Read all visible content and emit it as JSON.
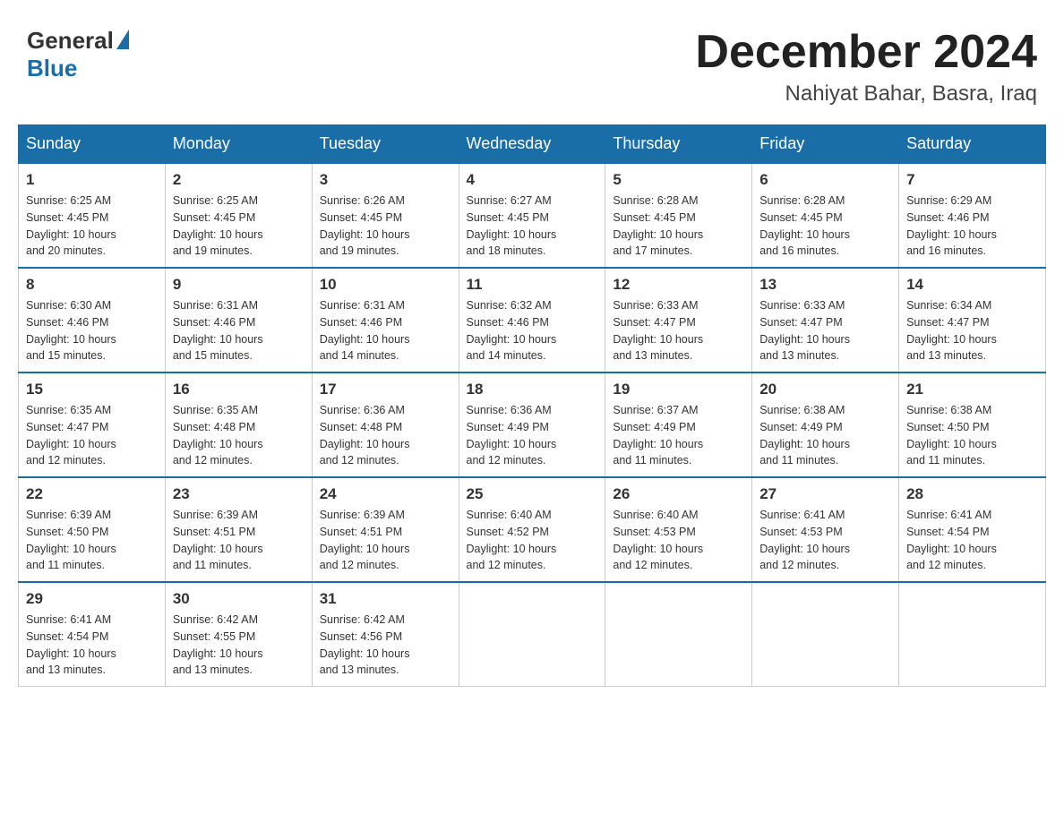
{
  "header": {
    "logo_general": "General",
    "logo_blue": "Blue",
    "month_title": "December 2024",
    "location": "Nahiyat Bahar, Basra, Iraq"
  },
  "days_of_week": [
    "Sunday",
    "Monday",
    "Tuesday",
    "Wednesday",
    "Thursday",
    "Friday",
    "Saturday"
  ],
  "weeks": [
    [
      {
        "day": "1",
        "sunrise": "6:25 AM",
        "sunset": "4:45 PM",
        "daylight": "10 hours and 20 minutes."
      },
      {
        "day": "2",
        "sunrise": "6:25 AM",
        "sunset": "4:45 PM",
        "daylight": "10 hours and 19 minutes."
      },
      {
        "day": "3",
        "sunrise": "6:26 AM",
        "sunset": "4:45 PM",
        "daylight": "10 hours and 19 minutes."
      },
      {
        "day": "4",
        "sunrise": "6:27 AM",
        "sunset": "4:45 PM",
        "daylight": "10 hours and 18 minutes."
      },
      {
        "day": "5",
        "sunrise": "6:28 AM",
        "sunset": "4:45 PM",
        "daylight": "10 hours and 17 minutes."
      },
      {
        "day": "6",
        "sunrise": "6:28 AM",
        "sunset": "4:45 PM",
        "daylight": "10 hours and 16 minutes."
      },
      {
        "day": "7",
        "sunrise": "6:29 AM",
        "sunset": "4:46 PM",
        "daylight": "10 hours and 16 minutes."
      }
    ],
    [
      {
        "day": "8",
        "sunrise": "6:30 AM",
        "sunset": "4:46 PM",
        "daylight": "10 hours and 15 minutes."
      },
      {
        "day": "9",
        "sunrise": "6:31 AM",
        "sunset": "4:46 PM",
        "daylight": "10 hours and 15 minutes."
      },
      {
        "day": "10",
        "sunrise": "6:31 AM",
        "sunset": "4:46 PM",
        "daylight": "10 hours and 14 minutes."
      },
      {
        "day": "11",
        "sunrise": "6:32 AM",
        "sunset": "4:46 PM",
        "daylight": "10 hours and 14 minutes."
      },
      {
        "day": "12",
        "sunrise": "6:33 AM",
        "sunset": "4:47 PM",
        "daylight": "10 hours and 13 minutes."
      },
      {
        "day": "13",
        "sunrise": "6:33 AM",
        "sunset": "4:47 PM",
        "daylight": "10 hours and 13 minutes."
      },
      {
        "day": "14",
        "sunrise": "6:34 AM",
        "sunset": "4:47 PM",
        "daylight": "10 hours and 13 minutes."
      }
    ],
    [
      {
        "day": "15",
        "sunrise": "6:35 AM",
        "sunset": "4:47 PM",
        "daylight": "10 hours and 12 minutes."
      },
      {
        "day": "16",
        "sunrise": "6:35 AM",
        "sunset": "4:48 PM",
        "daylight": "10 hours and 12 minutes."
      },
      {
        "day": "17",
        "sunrise": "6:36 AM",
        "sunset": "4:48 PM",
        "daylight": "10 hours and 12 minutes."
      },
      {
        "day": "18",
        "sunrise": "6:36 AM",
        "sunset": "4:49 PM",
        "daylight": "10 hours and 12 minutes."
      },
      {
        "day": "19",
        "sunrise": "6:37 AM",
        "sunset": "4:49 PM",
        "daylight": "10 hours and 11 minutes."
      },
      {
        "day": "20",
        "sunrise": "6:38 AM",
        "sunset": "4:49 PM",
        "daylight": "10 hours and 11 minutes."
      },
      {
        "day": "21",
        "sunrise": "6:38 AM",
        "sunset": "4:50 PM",
        "daylight": "10 hours and 11 minutes."
      }
    ],
    [
      {
        "day": "22",
        "sunrise": "6:39 AM",
        "sunset": "4:50 PM",
        "daylight": "10 hours and 11 minutes."
      },
      {
        "day": "23",
        "sunrise": "6:39 AM",
        "sunset": "4:51 PM",
        "daylight": "10 hours and 11 minutes."
      },
      {
        "day": "24",
        "sunrise": "6:39 AM",
        "sunset": "4:51 PM",
        "daylight": "10 hours and 12 minutes."
      },
      {
        "day": "25",
        "sunrise": "6:40 AM",
        "sunset": "4:52 PM",
        "daylight": "10 hours and 12 minutes."
      },
      {
        "day": "26",
        "sunrise": "6:40 AM",
        "sunset": "4:53 PM",
        "daylight": "10 hours and 12 minutes."
      },
      {
        "day": "27",
        "sunrise": "6:41 AM",
        "sunset": "4:53 PM",
        "daylight": "10 hours and 12 minutes."
      },
      {
        "day": "28",
        "sunrise": "6:41 AM",
        "sunset": "4:54 PM",
        "daylight": "10 hours and 12 minutes."
      }
    ],
    [
      {
        "day": "29",
        "sunrise": "6:41 AM",
        "sunset": "4:54 PM",
        "daylight": "10 hours and 13 minutes."
      },
      {
        "day": "30",
        "sunrise": "6:42 AM",
        "sunset": "4:55 PM",
        "daylight": "10 hours and 13 minutes."
      },
      {
        "day": "31",
        "sunrise": "6:42 AM",
        "sunset": "4:56 PM",
        "daylight": "10 hours and 13 minutes."
      },
      null,
      null,
      null,
      null
    ]
  ],
  "labels": {
    "sunrise": "Sunrise:",
    "sunset": "Sunset:",
    "daylight": "Daylight:"
  }
}
